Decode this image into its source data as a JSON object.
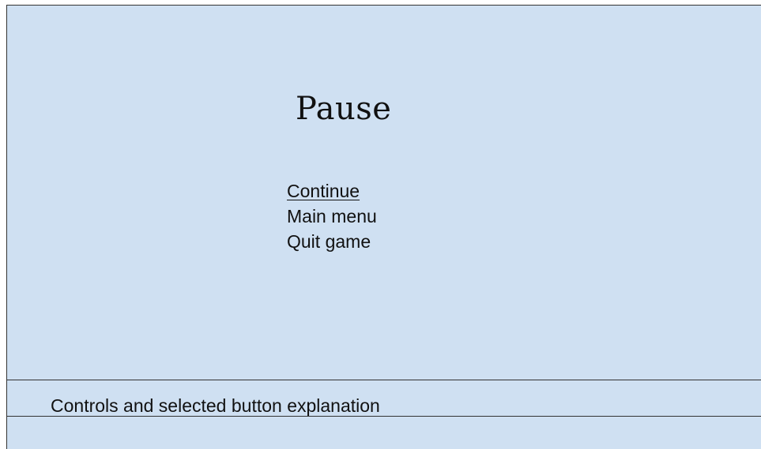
{
  "pause_screen": {
    "title": "Pause",
    "menu": [
      {
        "label": "Continue",
        "selected": true
      },
      {
        "label": "Main menu",
        "selected": false
      },
      {
        "label": "Quit game",
        "selected": false
      }
    ]
  },
  "footer": {
    "text": "Controls and selected button explanation"
  },
  "colors": {
    "background": "#cfe0f2",
    "text": "#111111",
    "lines": "#333333"
  }
}
